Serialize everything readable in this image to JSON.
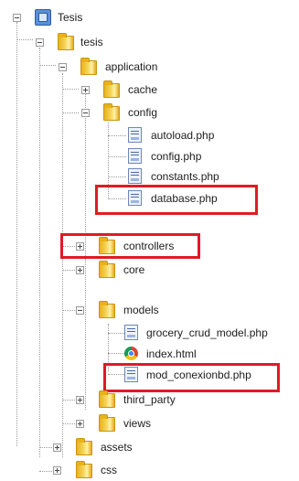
{
  "tree": {
    "root": {
      "label": "Tesis",
      "icon": "project-icon",
      "expanded": true
    },
    "tesis": {
      "label": "tesis",
      "icon": "folder-icon",
      "expanded": true
    },
    "application": {
      "label": "application",
      "icon": "folder-icon",
      "expanded": true
    },
    "cache": {
      "label": "cache",
      "icon": "folder-icon",
      "expanded": false
    },
    "config": {
      "label": "config",
      "icon": "folder-icon",
      "expanded": true
    },
    "autoload": {
      "label": "autoload.php",
      "icon": "php-file-icon"
    },
    "config_php": {
      "label": "config.php",
      "icon": "php-file-icon"
    },
    "constants": {
      "label": "constants.php",
      "icon": "php-file-icon"
    },
    "database": {
      "label": "database.php",
      "icon": "php-file-icon",
      "highlighted": true
    },
    "controllers": {
      "label": "controllers",
      "icon": "folder-icon",
      "expanded": false,
      "highlighted": true
    },
    "core": {
      "label": "core",
      "icon": "folder-icon",
      "expanded": false
    },
    "models": {
      "label": "models",
      "icon": "folder-icon",
      "expanded": true
    },
    "grocery": {
      "label": "grocery_crud_model.php",
      "icon": "php-file-icon"
    },
    "index_html": {
      "label": "index.html",
      "icon": "chrome-html-icon"
    },
    "mod_conexion": {
      "label": "mod_conexionbd.php",
      "icon": "php-file-icon",
      "highlighted": true
    },
    "third_party": {
      "label": "third_party",
      "icon": "folder-icon",
      "expanded": false
    },
    "views": {
      "label": "views",
      "icon": "folder-icon",
      "expanded": false
    },
    "assets": {
      "label": "assets",
      "icon": "folder-icon",
      "expanded": false
    },
    "css": {
      "label": "css",
      "icon": "folder-icon",
      "expanded": false
    }
  },
  "colors": {
    "highlight": "#e01b24",
    "folder": "#f0c53a",
    "guide": "#9a9a9a"
  }
}
